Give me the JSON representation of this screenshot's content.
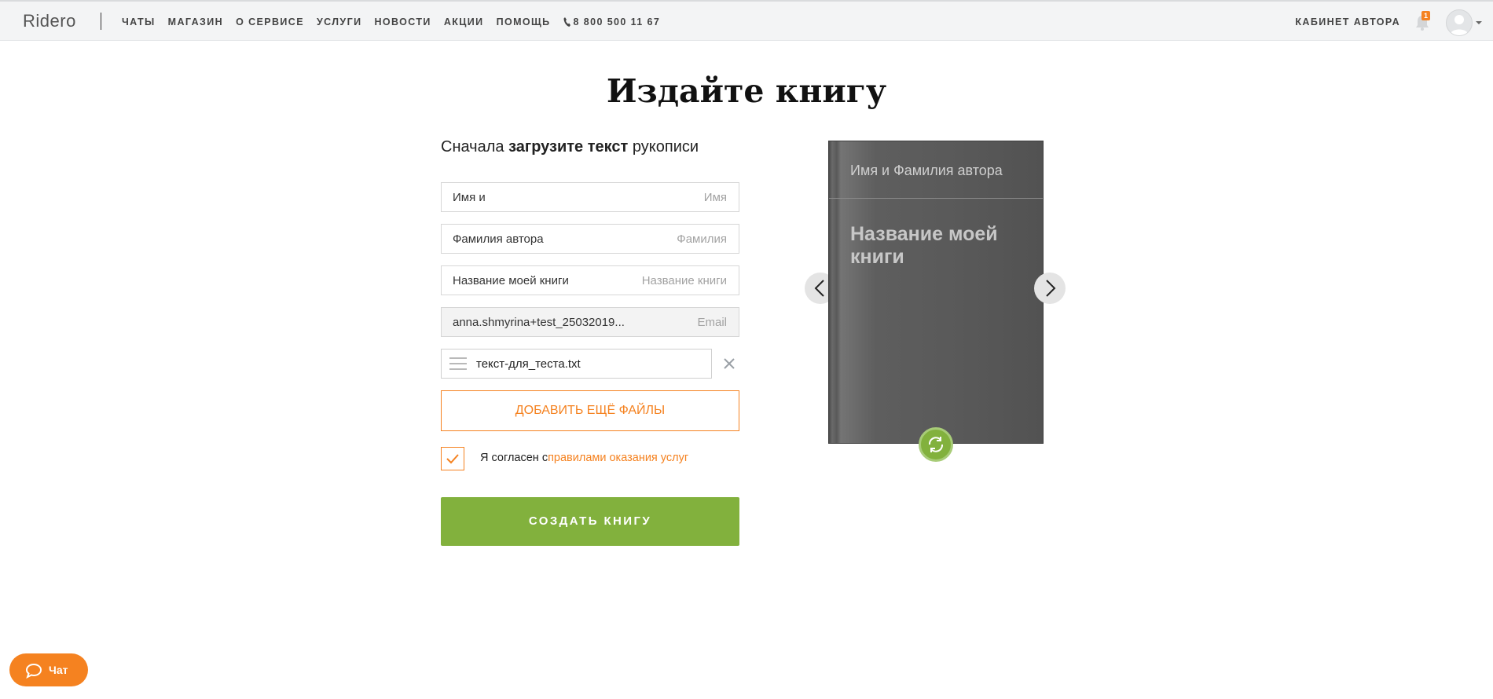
{
  "header": {
    "logo": "Ridero",
    "nav": [
      "ЧАТЫ",
      "МАГАЗИН",
      "О СЕРВИСЕ",
      "УСЛУГИ",
      "НОВОСТИ",
      "АКЦИИ",
      "ПОМОЩЬ"
    ],
    "phone": "8 800 500 11 67",
    "cabinet": "КАБИНЕТ АВТОРА",
    "notification_count": "1"
  },
  "page": {
    "title": "Издайте книгу",
    "subtitle_pre": "Сначала ",
    "subtitle_bold": "загрузите текст",
    "subtitle_post": " рукописи"
  },
  "form": {
    "first_name": {
      "value": "Имя и",
      "placeholder": "Имя"
    },
    "last_name": {
      "value": "Фамилия автора",
      "placeholder": "Фамилия"
    },
    "book_title": {
      "value": "Название моей книги",
      "placeholder": "Название книги"
    },
    "email": {
      "value": "anna.shmyrina+test_25032019...",
      "placeholder": "Email"
    },
    "file_name": "текст-для_теста.txt",
    "add_files": "ДОБАВИТЬ ЕЩЁ ФАЙЛЫ",
    "agree_text": "Я согласен с",
    "agree_link": "правилами оказания услуг",
    "agree_checked": true,
    "create_button": "СОЗДАТЬ КНИГУ"
  },
  "book_preview": {
    "author": "Имя и Фамилия автора",
    "title": "Название моей книги"
  },
  "chat": {
    "label": "Чат"
  },
  "colors": {
    "accent": "#f58220",
    "primary": "#82b13d",
    "cover": "#5a5a5a"
  }
}
